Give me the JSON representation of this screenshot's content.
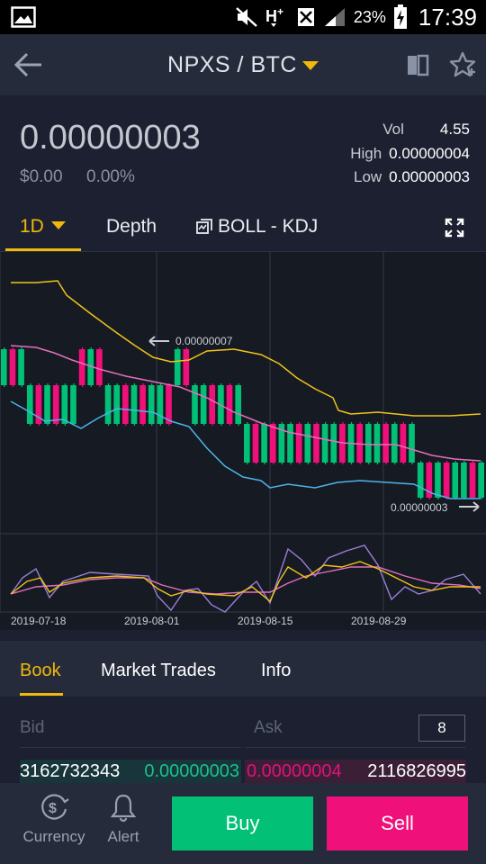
{
  "status_bar": {
    "battery_percent": "23%",
    "time": "17:39",
    "icons": [
      "image-icon",
      "mute-icon",
      "hplus-signal-icon",
      "sim-icon",
      "cell-signal-icon",
      "battery-charging-icon"
    ]
  },
  "header": {
    "pair": "NPXS / BTC",
    "icons": [
      "back-arrow-icon",
      "dropdown-caret-icon",
      "book-icon",
      "star-icon"
    ]
  },
  "summary": {
    "last_price": "0.00000003",
    "fiat_price": "$0.00",
    "change": "0.00%",
    "vol_label": "Vol",
    "vol_value": "4.55",
    "high_label": "High",
    "high_value": "0.00000004",
    "low_label": "Low",
    "low_value": "0.00000003"
  },
  "chart_tabs": {
    "interval": "1D",
    "depth": "Depth",
    "indicators": "BOLL - KDJ"
  },
  "chart_data": {
    "type": "candlestick",
    "indicators": [
      "BOLL",
      "KDJ"
    ],
    "high_marker": "0.00000007",
    "low_marker": "0.00000003",
    "x_ticks": [
      "2019-07-18",
      "2019-08-01",
      "2019-08-15",
      "2019-08-29"
    ],
    "colors": {
      "up": "#02c076",
      "down": "#f0107a",
      "boll_upper": "#f0c419",
      "boll_mid": "#e36fbf",
      "boll_lower": "#4fb3e8",
      "kdj_k": "#f0c419",
      "kdj_d": "#e36fbf",
      "kdj_j": "#9b7ed6"
    }
  },
  "book_tabs": {
    "book": "Book",
    "market_trades": "Market Trades",
    "info": "Info"
  },
  "order_book": {
    "bid_label": "Bid",
    "ask_label": "Ask",
    "precision": "8",
    "bids": [
      {
        "amount": "3162732343",
        "price": "0.00000003"
      }
    ],
    "asks": [
      {
        "price": "0.00000004",
        "amount": "2116826995"
      }
    ]
  },
  "bottom_bar": {
    "currency": "Currency",
    "alert": "Alert",
    "buy": "Buy",
    "sell": "Sell",
    "colors": {
      "buy": "#02c076",
      "sell": "#f0107a",
      "accent": "#f0b90b"
    }
  }
}
